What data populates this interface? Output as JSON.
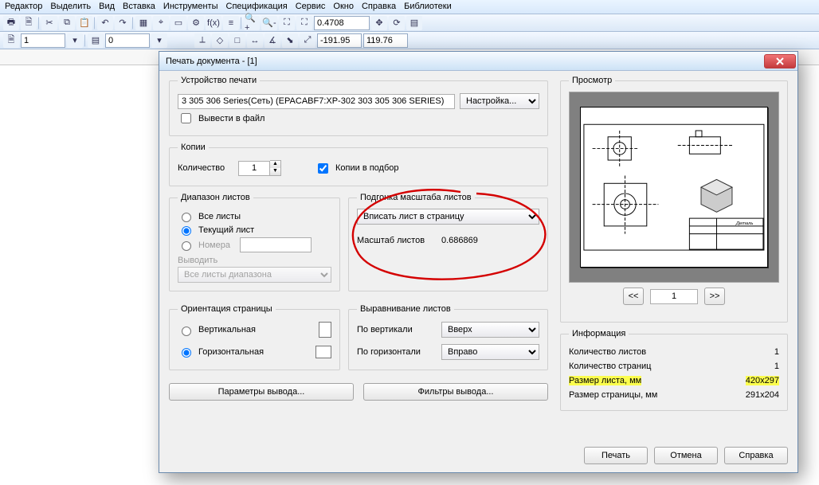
{
  "menubar": [
    "Редактор",
    "Выделить",
    "Вид",
    "Вставка",
    "Инструменты",
    "Спецификация",
    "Сервис",
    "Окно",
    "Справка",
    "Библиотеки"
  ],
  "toolbar_left_value": "1",
  "toolbar_layer_value": "0",
  "toolbar_scale_value": "0.4708",
  "coords_x": "-191.95",
  "coords_y": "119.76",
  "dialog": {
    "title": "Печать документа - [1]",
    "device_group": "Устройство печати",
    "device_name": "3 305 306 Series(Сеть) (EPACABF7:XP-302 303 305 306 SERIES)",
    "settings_btn": "Настройка...",
    "to_file_label": "Вывести в файл",
    "copies_group": "Копии",
    "qty_label": "Количество",
    "qty_value": "1",
    "collate_label": "Копии в подбор",
    "range_group": "Диапазон листов",
    "range_all": "Все листы",
    "range_current": "Текущий лист",
    "range_numbers": "Номера",
    "range_output_label": "Выводить",
    "range_output_select": "Все листы диапазона",
    "fit_group": "Подгонка масштаба листов",
    "fit_select": "Вписать лист в страницу",
    "fit_scale_label": "Масштаб листов",
    "fit_scale_value": "0.686869",
    "orient_group": "Ориентация страницы",
    "orient_v": "Вертикальная",
    "orient_h": "Горизонтальная",
    "align_group": "Выравнивание листов",
    "align_v_label": "По вертикали",
    "align_v_value": "Вверх",
    "align_h_label": "По горизонтали",
    "align_h_value": "Вправо",
    "param_btn": "Параметры вывода...",
    "filter_btn": "Фильтры вывода...",
    "preview_group": "Просмотр",
    "page_num": "1",
    "nav_prev": "<<",
    "nav_next": ">>",
    "info_group": "Информация",
    "info_rows": [
      {
        "k": "Количество листов",
        "v": "1"
      },
      {
        "k": "Количество страниц",
        "v": "1"
      },
      {
        "k": "Размер листа, мм",
        "v": "420x297",
        "hl": true
      },
      {
        "k": "Размер страницы, мм",
        "v": "291x204"
      }
    ],
    "print_btn": "Печать",
    "cancel_btn": "Отмена",
    "help_btn": "Справка"
  }
}
